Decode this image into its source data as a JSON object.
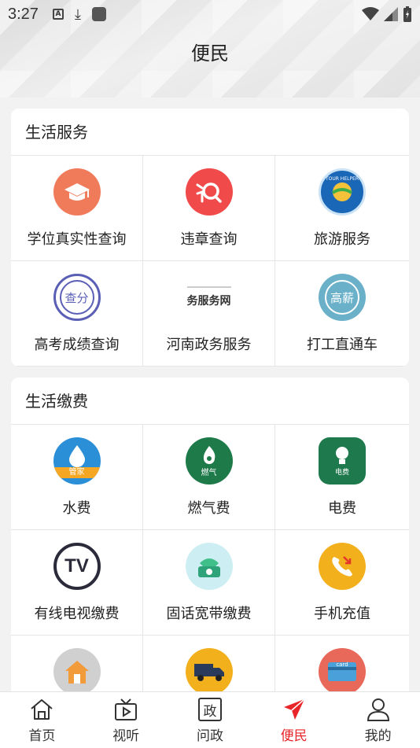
{
  "status_bar": {
    "time": "3:27"
  },
  "page": {
    "title": "便民"
  },
  "sections": [
    {
      "title": "生活服务",
      "items": [
        {
          "label": "学位真实性查询",
          "icon": "graduation-cap-icon",
          "color": "#f07b5a"
        },
        {
          "label": "违章查询",
          "icon": "violation-search-icon",
          "color": "#f04a4a"
        },
        {
          "label": "旅游服务",
          "icon": "tour-helper-icon",
          "color": "#1a67b8",
          "icon_text": "TOUR HELPER"
        },
        {
          "label": "高考成绩查询",
          "icon": "score-query-icon",
          "color": "#5a5fb5",
          "icon_text": "查分"
        },
        {
          "label": "河南政务服务",
          "icon": "gov-service-icon",
          "color": "#333333",
          "icon_text": "务服务网"
        },
        {
          "label": "打工直通车",
          "icon": "job-icon",
          "color": "#6ab0c8",
          "icon_text": "高薪"
        }
      ]
    },
    {
      "title": "生活缴费",
      "items": [
        {
          "label": "水费",
          "icon": "water-drop-icon",
          "color": "#2b8fd8",
          "icon_text": "管家"
        },
        {
          "label": "燃气费",
          "icon": "gas-flame-icon",
          "color": "#1f7a4a",
          "icon_text": "燃气"
        },
        {
          "label": "电费",
          "icon": "light-bulb-icon",
          "color": "#1e7a4c",
          "icon_text": "电费"
        },
        {
          "label": "有线电视缴费",
          "icon": "tv-icon",
          "color": "#2a2a3a",
          "icon_text": "TV"
        },
        {
          "label": "固话宽带缴费",
          "icon": "telephone-icon",
          "color": "#7ecfe0"
        },
        {
          "label": "手机充值",
          "icon": "phone-call-icon",
          "color": "#f2b11c"
        },
        {
          "label": "",
          "icon": "house-icon",
          "color": "#d0d0d0"
        },
        {
          "label": "",
          "icon": "truck-icon",
          "color": "#f2b11c"
        },
        {
          "label": "",
          "icon": "bank-card-icon",
          "color": "#e8685a",
          "icon_text": "card"
        }
      ]
    }
  ],
  "bottom_nav": [
    {
      "label": "首页",
      "icon": "home-icon",
      "active": false
    },
    {
      "label": "视听",
      "icon": "tv-play-icon",
      "active": false
    },
    {
      "label": "问政",
      "icon": "politics-icon",
      "active": false,
      "icon_text": "政"
    },
    {
      "label": "便民",
      "icon": "paper-plane-icon",
      "active": true
    },
    {
      "label": "我的",
      "icon": "person-icon",
      "active": false
    }
  ],
  "colors": {
    "accent": "#e8262a"
  }
}
